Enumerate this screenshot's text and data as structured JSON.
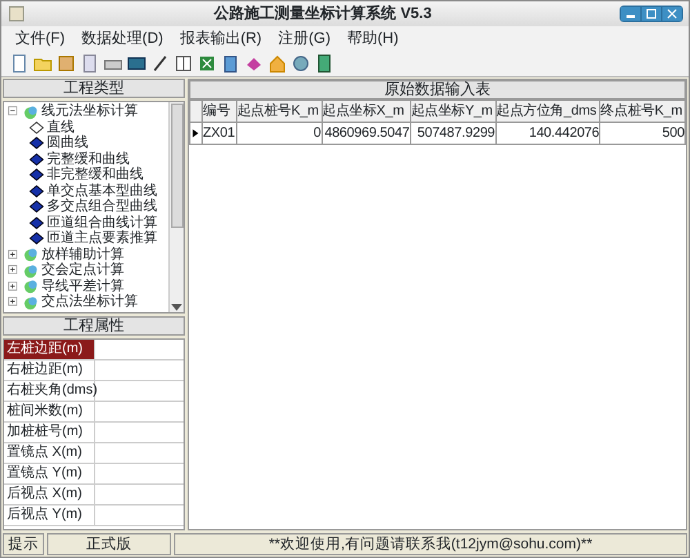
{
  "window": {
    "title": "公路施工测量坐标计算系统 V5.3"
  },
  "menu": [
    "文件(F)",
    "数据处理(D)",
    "报表输出(R)",
    "注册(G)",
    "帮助(H)"
  ],
  "tree": {
    "title": "工程类型",
    "nodes": [
      {
        "label": "线元法坐标计算",
        "expanded": true,
        "children": [
          {
            "label": "直线",
            "selected": true
          },
          {
            "label": "圆曲线",
            "selected": false
          },
          {
            "label": "完整缓和曲线",
            "selected": false
          },
          {
            "label": "非完整缓和曲线",
            "selected": false
          },
          {
            "label": "单交点基本型曲线",
            "selected": false
          },
          {
            "label": "多交点组合型曲线",
            "selected": false
          },
          {
            "label": "匝道组合曲线计算",
            "selected": false
          },
          {
            "label": "匝道主点要素推算",
            "selected": false
          }
        ]
      },
      {
        "label": "放样辅助计算",
        "expanded": false
      },
      {
        "label": "交会定点计算",
        "expanded": false
      },
      {
        "label": "导线平差计算",
        "expanded": false
      },
      {
        "label": "交点法坐标计算",
        "expanded": false
      }
    ]
  },
  "properties": {
    "title": "工程属性",
    "rows": [
      {
        "label": "左桩边距(m)",
        "selected": true
      },
      {
        "label": "右桩边距(m)",
        "selected": false
      },
      {
        "label": "右桩夹角(dms)",
        "selected": false
      },
      {
        "label": "桩间米数(m)",
        "selected": false
      },
      {
        "label": "加桩桩号(m)",
        "selected": false
      },
      {
        "label": "置镜点 X(m)",
        "selected": false
      },
      {
        "label": "置镜点 Y(m)",
        "selected": false
      },
      {
        "label": "后视点 X(m)",
        "selected": false
      },
      {
        "label": "后视点 Y(m)",
        "selected": false
      }
    ]
  },
  "table": {
    "title": "原始数据输入表",
    "columns": [
      "编号",
      "起点桩号K_m",
      "起点坐标X_m",
      "起点坐标Y_m",
      "起点方位角_dms",
      "终点桩号K_m"
    ],
    "rows": [
      {
        "current": true,
        "cells": [
          "ZX01",
          "0",
          "4860969.5047",
          "507487.9299",
          "140.442076",
          "500"
        ]
      }
    ]
  },
  "status_bar": [
    "提示",
    "正式版",
    "**欢迎使用,有问题请联系我(t12jym@sohu.com)**"
  ]
}
